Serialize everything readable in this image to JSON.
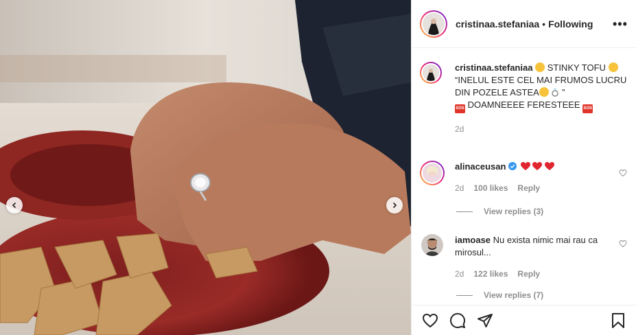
{
  "post": {
    "username": "cristinaa.stefaniaa",
    "separator": "•",
    "follow_status": "Following",
    "more_label": "•••"
  },
  "caption": {
    "username": "cristinaa.stefaniaa",
    "line1": "STINKY TOFU",
    "line2": "“INELUL ESTE CEL MAI FRUMOS LUCRU DIN POZELE ASTEA",
    "line2_end": "”",
    "line3": "DOAMNEEEE FERESTEEE",
    "time": "2d"
  },
  "comments": [
    {
      "username": "alinaceusan",
      "verified": true,
      "text": "",
      "time": "2d",
      "likes": "100 likes",
      "reply_label": "Reply",
      "view_replies": "View replies (3)"
    },
    {
      "username": "iamoase",
      "verified": false,
      "text": "Nu exista nimic mai rau ca mirosul...",
      "time": "2d",
      "likes": "122 likes",
      "reply_label": "Reply",
      "view_replies": "View replies (7)"
    }
  ],
  "icons": {
    "like": "heart-icon",
    "comment": "comment-icon",
    "share": "share-icon",
    "save": "bookmark-icon",
    "prev": "chevron-left-icon",
    "next": "chevron-right-icon"
  },
  "colors": {
    "heart_red": "#ed4956",
    "verified_blue": "#3897f0",
    "text": "#262626",
    "muted": "#8e8e8e",
    "border": "#efefef"
  }
}
